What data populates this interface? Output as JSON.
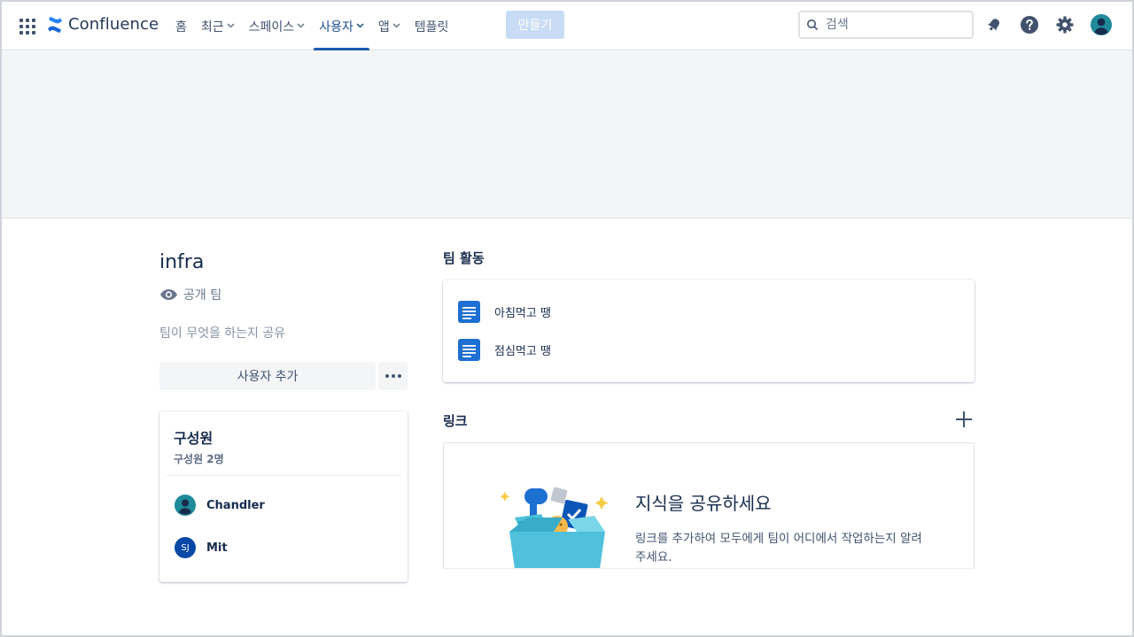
{
  "app": {
    "name": "Confluence"
  },
  "nav": {
    "items": [
      {
        "label": "홈",
        "has_menu": false,
        "active": false
      },
      {
        "label": "최근",
        "has_menu": true,
        "active": false
      },
      {
        "label": "스페이스",
        "has_menu": true,
        "active": false
      },
      {
        "label": "사용자",
        "has_menu": true,
        "active": true
      },
      {
        "label": "앱",
        "has_menu": true,
        "active": false
      },
      {
        "label": "템플릿",
        "has_menu": false,
        "active": false
      }
    ],
    "create_label": "만들기"
  },
  "search": {
    "placeholder": "검색"
  },
  "icons": {
    "apps": "apps-grid-icon",
    "notifications": "bell-icon",
    "help": "help-icon",
    "settings": "gear-icon",
    "profile": "avatar-icon",
    "visibility": "eye-icon",
    "page": "page-icon",
    "add": "plus-icon"
  },
  "colors": {
    "brand": "#0052cc",
    "active_nav": "#1d5ab0",
    "create_button": "#c8dcf5"
  },
  "team": {
    "name": "infra",
    "visibility": "공개 팀",
    "description_placeholder": "팀이 무엇을 하는지 공유",
    "add_user_label": "사용자 추가"
  },
  "members": {
    "title": "구성원",
    "count_label": "구성원 2명",
    "list": [
      {
        "name": "Chandler",
        "initials": ""
      },
      {
        "name": "Mit",
        "initials": "SJ"
      }
    ]
  },
  "activity": {
    "title": "팀 활동",
    "items": [
      {
        "title": "아침먹고 땡"
      },
      {
        "title": "점심먹고 땡"
      }
    ]
  },
  "links": {
    "title": "링크",
    "empty_heading": "지식을 공유하세요",
    "empty_description": "링크를 추가하여 모두에게 팀이 어디에서 작업하는지 알려주세요."
  }
}
